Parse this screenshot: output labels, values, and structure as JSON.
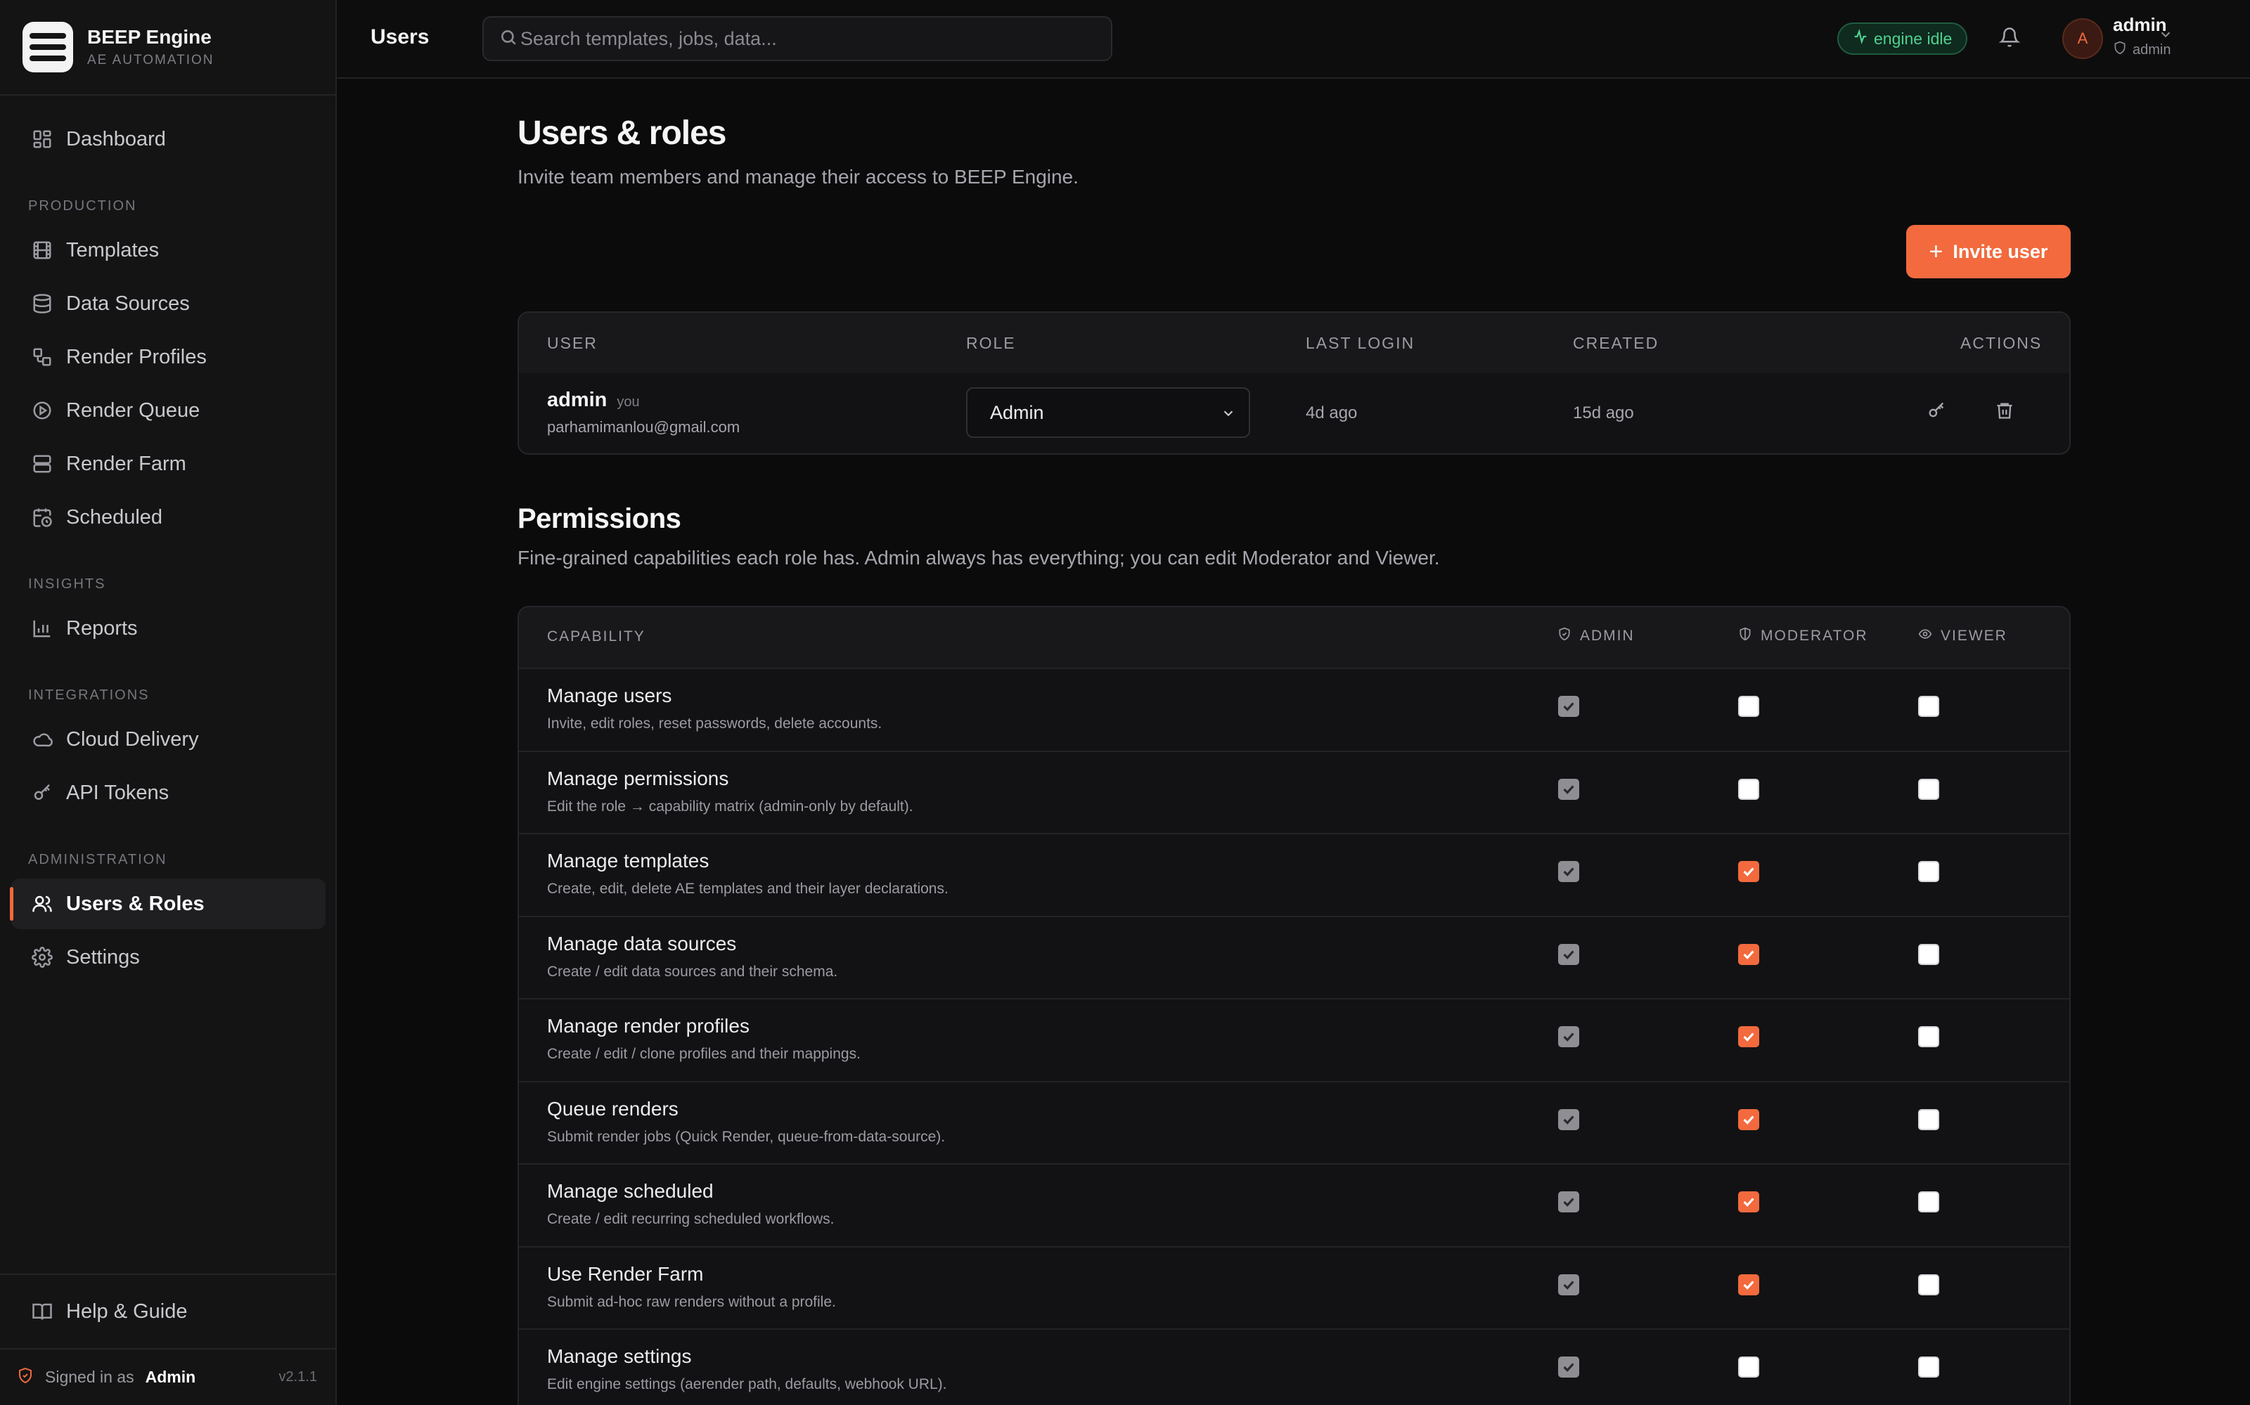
{
  "brand": {
    "name": "BEEP Engine",
    "subtitle": "AE AUTOMATION"
  },
  "sidebar": {
    "top": [
      {
        "label": "Dashboard",
        "icon": "dashboard-icon"
      }
    ],
    "sections": [
      {
        "label": "PRODUCTION",
        "items": [
          {
            "label": "Templates",
            "icon": "film-icon"
          },
          {
            "label": "Data Sources",
            "icon": "database-icon"
          },
          {
            "label": "Render Profiles",
            "icon": "profiles-icon"
          },
          {
            "label": "Render Queue",
            "icon": "play-circle-icon"
          },
          {
            "label": "Render Farm",
            "icon": "server-icon"
          },
          {
            "label": "Scheduled",
            "icon": "calendar-clock-icon"
          }
        ]
      },
      {
        "label": "INSIGHTS",
        "items": [
          {
            "label": "Reports",
            "icon": "bar-chart-icon"
          }
        ]
      },
      {
        "label": "INTEGRATIONS",
        "items": [
          {
            "label": "Cloud Delivery",
            "icon": "cloud-icon"
          },
          {
            "label": "API Tokens",
            "icon": "key-icon"
          }
        ]
      },
      {
        "label": "ADMINISTRATION",
        "items": [
          {
            "label": "Users & Roles",
            "icon": "users-icon",
            "active": true
          },
          {
            "label": "Settings",
            "icon": "gear-icon"
          }
        ]
      }
    ],
    "help": "Help & Guide",
    "signed_in_prefix": "Signed in as",
    "signed_in_role": "Admin",
    "version": "v2.1.1"
  },
  "topbar": {
    "title": "Users",
    "search_placeholder": "Search templates, jobs, data...",
    "status": "engine idle",
    "status_color": "#4fd08f",
    "avatar_initial": "A",
    "user_name": "admin",
    "user_role": "admin"
  },
  "page": {
    "title": "Users & roles",
    "subtitle": "Invite team members and manage their access to BEEP Engine.",
    "invite_label": "Invite user",
    "accent": "#f26a3d"
  },
  "users_table": {
    "headers": {
      "user": "USER",
      "role": "ROLE",
      "last_login": "LAST LOGIN",
      "created": "CREATED",
      "actions": "ACTIONS"
    },
    "rows": [
      {
        "name": "admin",
        "you_tag": "you",
        "email": "parhamimanlou@gmail.com",
        "role": "Admin",
        "last_login": "4d ago",
        "created": "15d ago"
      }
    ]
  },
  "permissions": {
    "title": "Permissions",
    "subtitle": "Fine-grained capabilities each role has. Admin always has everything; you can edit Moderator and Viewer.",
    "headers": {
      "capability": "CAPABILITY",
      "admin": "ADMIN",
      "moderator": "MODERATOR",
      "viewer": "VIEWER"
    },
    "rows": [
      {
        "name": "Manage users",
        "desc": "Invite, edit roles, reset passwords, delete accounts.",
        "admin": true,
        "moderator": false,
        "viewer": false
      },
      {
        "name": "Manage permissions",
        "desc": "Edit the role → capability matrix (admin-only by default).",
        "admin": true,
        "moderator": false,
        "viewer": false
      },
      {
        "name": "Manage templates",
        "desc": "Create, edit, delete AE templates and their layer declarations.",
        "admin": true,
        "moderator": true,
        "viewer": false
      },
      {
        "name": "Manage data sources",
        "desc": "Create / edit data sources and their schema.",
        "admin": true,
        "moderator": true,
        "viewer": false
      },
      {
        "name": "Manage render profiles",
        "desc": "Create / edit / clone profiles and their mappings.",
        "admin": true,
        "moderator": true,
        "viewer": false
      },
      {
        "name": "Queue renders",
        "desc": "Submit render jobs (Quick Render, queue-from-data-source).",
        "admin": true,
        "moderator": true,
        "viewer": false
      },
      {
        "name": "Manage scheduled",
        "desc": "Create / edit recurring scheduled workflows.",
        "admin": true,
        "moderator": true,
        "viewer": false
      },
      {
        "name": "Use Render Farm",
        "desc": "Submit ad-hoc raw renders without a profile.",
        "admin": true,
        "moderator": true,
        "viewer": false
      },
      {
        "name": "Manage settings",
        "desc": "Edit engine settings (aerender path, defaults, webhook URL).",
        "admin": true,
        "moderator": false,
        "viewer": false
      }
    ]
  }
}
